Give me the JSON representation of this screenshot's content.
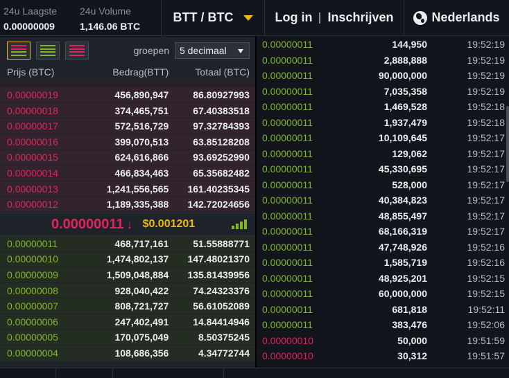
{
  "header": {
    "low_label": "24u Laagste",
    "low_value": "0.00000009",
    "volume_label": "24u Volume",
    "volume_value": "1,146.06 BTC",
    "pair": "BTT / BTC",
    "login": "Log in",
    "register": "Inschrijven",
    "language": "Nederlands"
  },
  "orderbook": {
    "group_label": "groepen",
    "group_value": "5 decimaal",
    "columns": [
      "Prijs (BTC)",
      "Bedrag(BTT)",
      "Totaal (BTC)"
    ],
    "asks": [
      [
        "0.00000019",
        "456,890,947",
        "86.80927993"
      ],
      [
        "0.00000018",
        "374,465,751",
        "67.40383518"
      ],
      [
        "0.00000017",
        "572,516,729",
        "97.32784393"
      ],
      [
        "0.00000016",
        "399,070,513",
        "63.85128208"
      ],
      [
        "0.00000015",
        "624,616,866",
        "93.69252990"
      ],
      [
        "0.00000014",
        "466,834,463",
        "65.35682482"
      ],
      [
        "0.00000013",
        "1,241,556,565",
        "161.40235345"
      ],
      [
        "0.00000012",
        "1,189,335,388",
        "142.72024656"
      ]
    ],
    "last_price": "0.00000011",
    "usd_price": "$0.001201",
    "bids": [
      [
        "0.00000011",
        "468,717,161",
        "51.55888771"
      ],
      [
        "0.00000010",
        "1,474,802,137",
        "147.48021370"
      ],
      [
        "0.00000009",
        "1,509,048,884",
        "135.81439956"
      ],
      [
        "0.00000008",
        "928,040,422",
        "74.24323376"
      ],
      [
        "0.00000007",
        "808,721,727",
        "56.61052089"
      ],
      [
        "0.00000006",
        "247,402,491",
        "14.84414946"
      ],
      [
        "0.00000005",
        "170,075,049",
        "8.50375245"
      ],
      [
        "0.00000004",
        "108,686,356",
        "4.34772744"
      ]
    ]
  },
  "trades": [
    {
      "price": "0.00000011",
      "amount": "144,950",
      "time": "19:52:19",
      "side": "buy"
    },
    {
      "price": "0.00000011",
      "amount": "2,888,888",
      "time": "19:52:19",
      "side": "buy"
    },
    {
      "price": "0.00000011",
      "amount": "90,000,000",
      "time": "19:52:19",
      "side": "buy"
    },
    {
      "price": "0.00000011",
      "amount": "7,035,358",
      "time": "19:52:19",
      "side": "buy"
    },
    {
      "price": "0.00000011",
      "amount": "1,469,528",
      "time": "19:52:18",
      "side": "buy"
    },
    {
      "price": "0.00000011",
      "amount": "1,937,479",
      "time": "19:52:18",
      "side": "buy"
    },
    {
      "price": "0.00000011",
      "amount": "10,109,645",
      "time": "19:52:17",
      "side": "buy"
    },
    {
      "price": "0.00000011",
      "amount": "129,062",
      "time": "19:52:17",
      "side": "buy"
    },
    {
      "price": "0.00000011",
      "amount": "45,330,695",
      "time": "19:52:17",
      "side": "buy"
    },
    {
      "price": "0.00000011",
      "amount": "528,000",
      "time": "19:52:17",
      "side": "buy"
    },
    {
      "price": "0.00000011",
      "amount": "40,384,823",
      "time": "19:52:17",
      "side": "buy"
    },
    {
      "price": "0.00000011",
      "amount": "48,855,497",
      "time": "19:52:17",
      "side": "buy"
    },
    {
      "price": "0.00000011",
      "amount": "68,166,319",
      "time": "19:52:17",
      "side": "buy"
    },
    {
      "price": "0.00000011",
      "amount": "47,748,926",
      "time": "19:52:16",
      "side": "buy"
    },
    {
      "price": "0.00000011",
      "amount": "1,585,719",
      "time": "19:52:16",
      "side": "buy"
    },
    {
      "price": "0.00000011",
      "amount": "48,925,201",
      "time": "19:52:15",
      "side": "buy"
    },
    {
      "price": "0.00000011",
      "amount": "60,000,000",
      "time": "19:52:15",
      "side": "buy"
    },
    {
      "price": "0.00000011",
      "amount": "681,818",
      "time": "19:52:11",
      "side": "buy"
    },
    {
      "price": "0.00000011",
      "amount": "383,476",
      "time": "19:52:06",
      "side": "buy"
    },
    {
      "price": "0.00000010",
      "amount": "50,000",
      "time": "19:51:59",
      "side": "sell"
    },
    {
      "price": "0.00000010",
      "amount": "30,312",
      "time": "19:51:57",
      "side": "sell"
    }
  ],
  "colors": {
    "buy": "#84b52b",
    "sell": "#e0245e",
    "accent": "#f0b90b"
  },
  "icons": {
    "language": "globe-icon",
    "pair_toggle": "caret-down-icon",
    "trend": "arrow-down-icon",
    "signal": "signal-bars-icon"
  }
}
